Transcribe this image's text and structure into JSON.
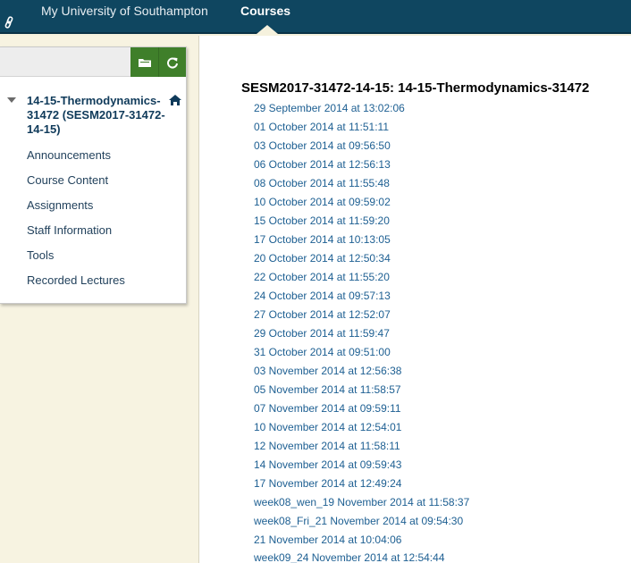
{
  "topnav": {
    "home_label": "My University of Southampton",
    "courses_label": "Courses"
  },
  "course_menu": {
    "course_title": "14-15-Thermodynamics-31472 (SESM2017-31472-14-15)",
    "items": [
      {
        "label": "Announcements"
      },
      {
        "label": "Course Content"
      },
      {
        "label": "Assignments"
      },
      {
        "label": "Staff Information"
      },
      {
        "label": "Tools"
      },
      {
        "label": "Recorded Lectures"
      }
    ]
  },
  "content": {
    "title": "SESM2017-31472-14-15: 14-15-Thermodynamics-31472",
    "recordings": [
      "29 September 2014 at 13:02:06",
      "01 October 2014 at 11:51:11",
      "03 October 2014 at 09:56:50",
      "06 October 2014 at 12:56:13",
      "08 October 2014 at 11:55:48",
      "10 October 2014 at 09:59:02",
      "15 October 2014 at 11:59:20",
      "17 October 2014 at 10:13:05",
      "20 October 2014 at 12:50:34",
      "22 October 2014 at 11:55:20",
      "24 October 2014 at 09:57:13",
      "27 October 2014 at 12:52:07",
      "29 October 2014 at 11:59:47",
      "31 October 2014 at 09:51:00",
      "03 November 2014 at 12:56:38",
      "05 November 2014 at 11:58:57",
      "07 November 2014 at 09:59:11",
      "10 November 2014 at 12:54:01",
      "12 November 2014 at 11:58:11",
      "14 November 2014 at 09:59:43",
      "17 November 2014 at 12:49:24",
      "week08_wen_19 November 2014 at 11:58:37",
      "week08_Fri_21 November 2014 at 09:54:30",
      "21 November 2014 at 10:04:06",
      "week09_24 November 2014 at 12:54:44"
    ]
  },
  "icons": {
    "link": "link-icon",
    "folder": "folder-icon",
    "refresh": "refresh-icon",
    "home": "home-icon"
  },
  "colors": {
    "topbar": "#0f4660",
    "menu_button": "#3f7f2a",
    "link": "#1d5f92",
    "background": "#f5f1dd"
  }
}
